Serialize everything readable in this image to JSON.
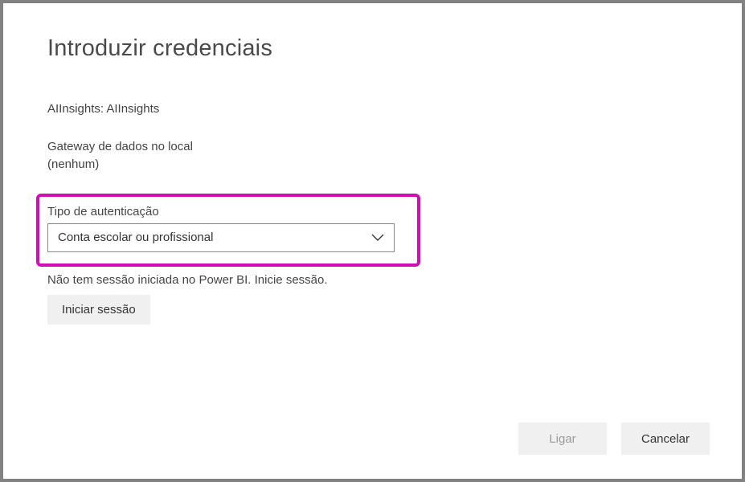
{
  "dialog": {
    "title": "Introduzir credenciais",
    "datasource_line": "AIInsights: AIInsights",
    "gateway_label": "Gateway de dados no local",
    "gateway_value": "(nenhum)",
    "auth_type_label": "Tipo de autenticação",
    "auth_type_value": "Conta escolar ou profissional",
    "status_text": "Não tem sessão iniciada no Power BI. Inicie sessão.",
    "signin_button": "Iniciar sessão",
    "connect_button": "Ligar",
    "cancel_button": "Cancelar"
  }
}
